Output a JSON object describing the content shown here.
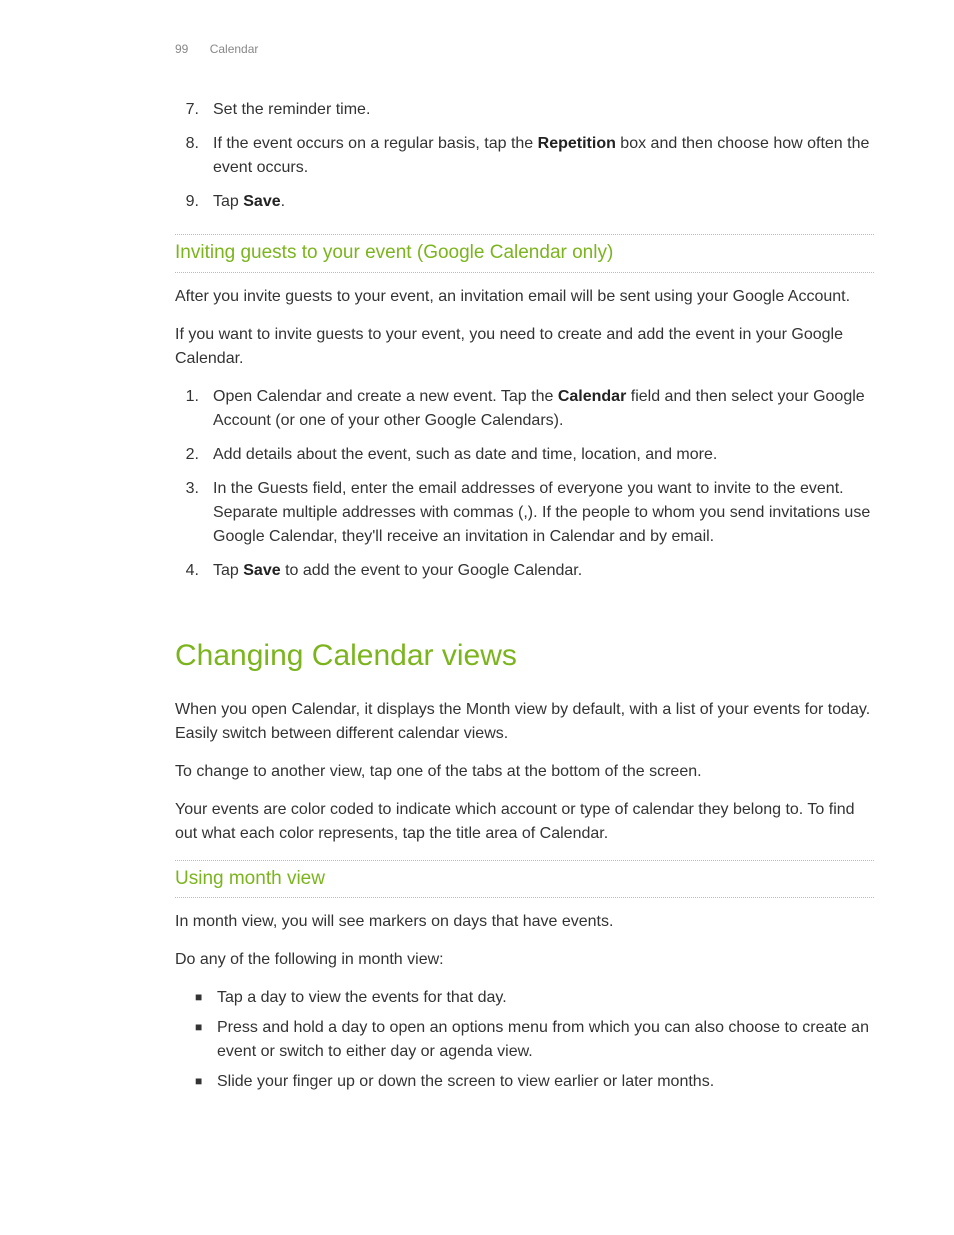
{
  "header": {
    "page_number": "99",
    "section": "Calendar"
  },
  "top_list": [
    {
      "num": "7.",
      "text": "Set the reminder time."
    },
    {
      "num": "8.",
      "parts": [
        "If the event occurs on a regular basis, tap the ",
        "Repetition",
        " box and then choose how often the event occurs."
      ]
    },
    {
      "num": "9.",
      "parts": [
        "Tap ",
        "Save",
        "."
      ]
    }
  ],
  "section1": {
    "heading": "Inviting guests to your event (Google Calendar only)",
    "para1": "After you invite guests to your event, an invitation email will be sent using your Google Account.",
    "para2": "If you want to invite guests to your event, you need to create and add the event in your Google Calendar.",
    "list": [
      {
        "num": "1.",
        "parts": [
          "Open Calendar and create a new event. Tap the ",
          "Calendar",
          " field and then select your Google Account (or one of your other Google Calendars)."
        ]
      },
      {
        "num": "2.",
        "text": "Add details about the event, such as date and time, location, and more."
      },
      {
        "num": "3.",
        "text": "In the Guests field, enter the email addresses of everyone you want to invite to the event. Separate multiple addresses with commas (,). If the people to whom you send invitations use Google Calendar, they'll receive an invitation in Calendar and by email."
      },
      {
        "num": "4.",
        "parts": [
          "Tap ",
          "Save",
          " to add the event to your Google Calendar."
        ]
      }
    ]
  },
  "section2": {
    "heading": "Changing Calendar views",
    "para1": "When you open Calendar, it displays the Month view by default, with a list of your events for today. Easily switch between different calendar views.",
    "para2": "To change to another view, tap one of the tabs at the bottom of the screen.",
    "para3": "Your events are color coded to indicate which account or type of calendar they belong to. To find out what each color represents, tap the title area of Calendar."
  },
  "section3": {
    "heading": "Using month view",
    "para1": "In month view, you will see markers on days that have events.",
    "para2": "Do any of the following in month view:",
    "bullets": [
      "Tap a day to view the events for that day.",
      "Press and hold a day to open an options menu from which you can also choose to create an event or switch to either day or agenda view.",
      "Slide your finger up or down the screen to view earlier or later months."
    ]
  }
}
